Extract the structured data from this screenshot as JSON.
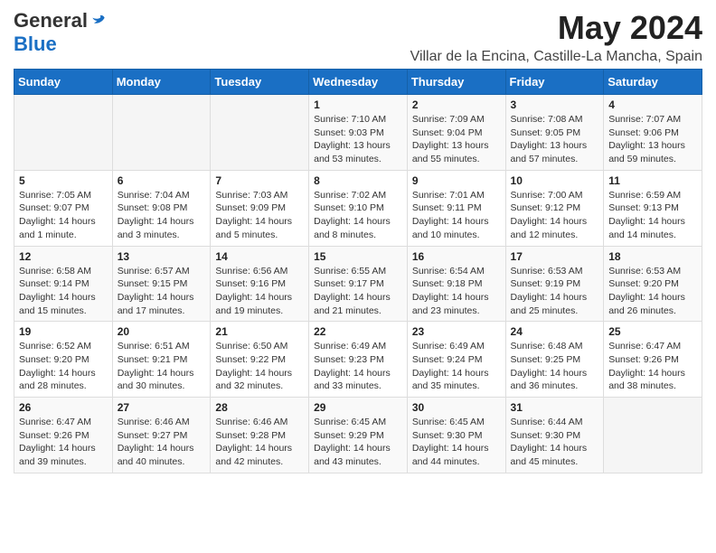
{
  "header": {
    "logo_general": "General",
    "logo_blue": "Blue",
    "title": "May 2024",
    "subtitle": "Villar de la Encina, Castille-La Mancha, Spain"
  },
  "weekdays": [
    "Sunday",
    "Monday",
    "Tuesday",
    "Wednesday",
    "Thursday",
    "Friday",
    "Saturday"
  ],
  "weeks": [
    [
      {
        "day": "",
        "info": ""
      },
      {
        "day": "",
        "info": ""
      },
      {
        "day": "",
        "info": ""
      },
      {
        "day": "1",
        "info": "Sunrise: 7:10 AM\nSunset: 9:03 PM\nDaylight: 13 hours and 53 minutes."
      },
      {
        "day": "2",
        "info": "Sunrise: 7:09 AM\nSunset: 9:04 PM\nDaylight: 13 hours and 55 minutes."
      },
      {
        "day": "3",
        "info": "Sunrise: 7:08 AM\nSunset: 9:05 PM\nDaylight: 13 hours and 57 minutes."
      },
      {
        "day": "4",
        "info": "Sunrise: 7:07 AM\nSunset: 9:06 PM\nDaylight: 13 hours and 59 minutes."
      }
    ],
    [
      {
        "day": "5",
        "info": "Sunrise: 7:05 AM\nSunset: 9:07 PM\nDaylight: 14 hours and 1 minute."
      },
      {
        "day": "6",
        "info": "Sunrise: 7:04 AM\nSunset: 9:08 PM\nDaylight: 14 hours and 3 minutes."
      },
      {
        "day": "7",
        "info": "Sunrise: 7:03 AM\nSunset: 9:09 PM\nDaylight: 14 hours and 5 minutes."
      },
      {
        "day": "8",
        "info": "Sunrise: 7:02 AM\nSunset: 9:10 PM\nDaylight: 14 hours and 8 minutes."
      },
      {
        "day": "9",
        "info": "Sunrise: 7:01 AM\nSunset: 9:11 PM\nDaylight: 14 hours and 10 minutes."
      },
      {
        "day": "10",
        "info": "Sunrise: 7:00 AM\nSunset: 9:12 PM\nDaylight: 14 hours and 12 minutes."
      },
      {
        "day": "11",
        "info": "Sunrise: 6:59 AM\nSunset: 9:13 PM\nDaylight: 14 hours and 14 minutes."
      }
    ],
    [
      {
        "day": "12",
        "info": "Sunrise: 6:58 AM\nSunset: 9:14 PM\nDaylight: 14 hours and 15 minutes."
      },
      {
        "day": "13",
        "info": "Sunrise: 6:57 AM\nSunset: 9:15 PM\nDaylight: 14 hours and 17 minutes."
      },
      {
        "day": "14",
        "info": "Sunrise: 6:56 AM\nSunset: 9:16 PM\nDaylight: 14 hours and 19 minutes."
      },
      {
        "day": "15",
        "info": "Sunrise: 6:55 AM\nSunset: 9:17 PM\nDaylight: 14 hours and 21 minutes."
      },
      {
        "day": "16",
        "info": "Sunrise: 6:54 AM\nSunset: 9:18 PM\nDaylight: 14 hours and 23 minutes."
      },
      {
        "day": "17",
        "info": "Sunrise: 6:53 AM\nSunset: 9:19 PM\nDaylight: 14 hours and 25 minutes."
      },
      {
        "day": "18",
        "info": "Sunrise: 6:53 AM\nSunset: 9:20 PM\nDaylight: 14 hours and 26 minutes."
      }
    ],
    [
      {
        "day": "19",
        "info": "Sunrise: 6:52 AM\nSunset: 9:20 PM\nDaylight: 14 hours and 28 minutes."
      },
      {
        "day": "20",
        "info": "Sunrise: 6:51 AM\nSunset: 9:21 PM\nDaylight: 14 hours and 30 minutes."
      },
      {
        "day": "21",
        "info": "Sunrise: 6:50 AM\nSunset: 9:22 PM\nDaylight: 14 hours and 32 minutes."
      },
      {
        "day": "22",
        "info": "Sunrise: 6:49 AM\nSunset: 9:23 PM\nDaylight: 14 hours and 33 minutes."
      },
      {
        "day": "23",
        "info": "Sunrise: 6:49 AM\nSunset: 9:24 PM\nDaylight: 14 hours and 35 minutes."
      },
      {
        "day": "24",
        "info": "Sunrise: 6:48 AM\nSunset: 9:25 PM\nDaylight: 14 hours and 36 minutes."
      },
      {
        "day": "25",
        "info": "Sunrise: 6:47 AM\nSunset: 9:26 PM\nDaylight: 14 hours and 38 minutes."
      }
    ],
    [
      {
        "day": "26",
        "info": "Sunrise: 6:47 AM\nSunset: 9:26 PM\nDaylight: 14 hours and 39 minutes."
      },
      {
        "day": "27",
        "info": "Sunrise: 6:46 AM\nSunset: 9:27 PM\nDaylight: 14 hours and 40 minutes."
      },
      {
        "day": "28",
        "info": "Sunrise: 6:46 AM\nSunset: 9:28 PM\nDaylight: 14 hours and 42 minutes."
      },
      {
        "day": "29",
        "info": "Sunrise: 6:45 AM\nSunset: 9:29 PM\nDaylight: 14 hours and 43 minutes."
      },
      {
        "day": "30",
        "info": "Sunrise: 6:45 AM\nSunset: 9:30 PM\nDaylight: 14 hours and 44 minutes."
      },
      {
        "day": "31",
        "info": "Sunrise: 6:44 AM\nSunset: 9:30 PM\nDaylight: 14 hours and 45 minutes."
      },
      {
        "day": "",
        "info": ""
      }
    ]
  ]
}
